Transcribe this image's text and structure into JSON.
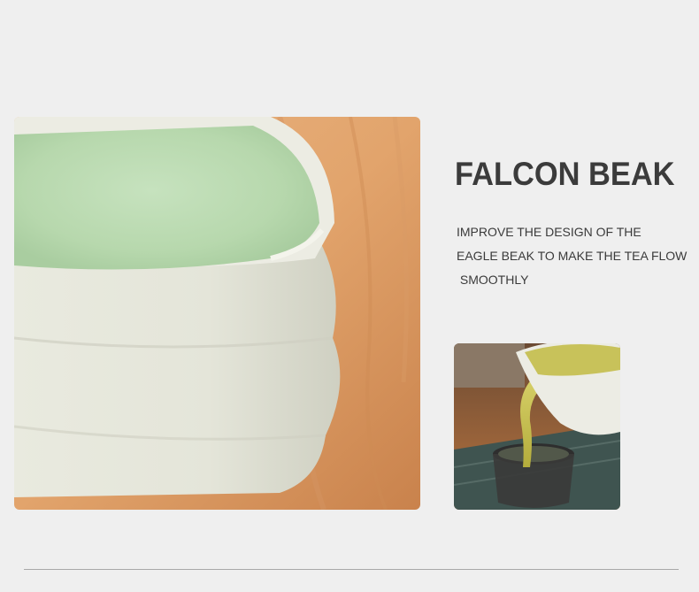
{
  "feature": {
    "title": "FALCON BEAK",
    "description_lines": [
      "IMPROVE THE DESIGN OF THE",
      "EAGLE BEAK TO MAKE THE TEA FLOW",
      " SMOOTHLY"
    ]
  },
  "images": {
    "hero": "white-matcha-bowl-with-pouring-spout-on-wooden-table",
    "detail": "pouring-green-tea-into-glass-cup"
  },
  "colors": {
    "background": "#efefef",
    "title": "#3b3b3b",
    "text": "#3a3a3a",
    "divider": "#a9a9a9"
  }
}
